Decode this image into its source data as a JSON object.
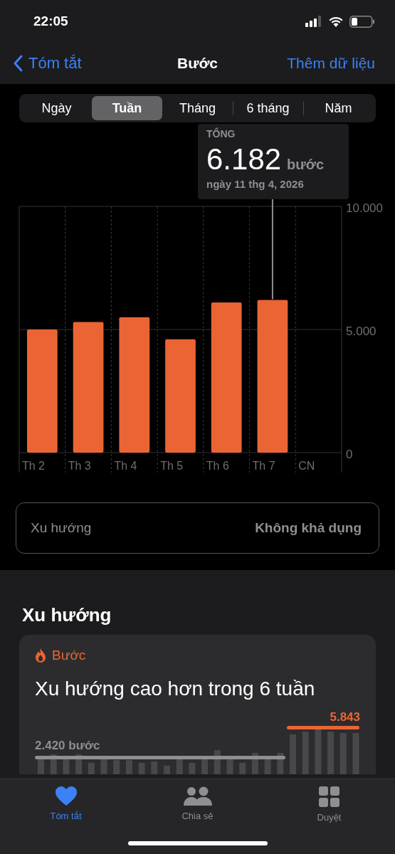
{
  "status_bar": {
    "time": "22:05"
  },
  "nav": {
    "back": "Tóm tắt",
    "title": "Bước",
    "action": "Thêm dữ liệu"
  },
  "segments": [
    {
      "label": "Ngày",
      "selected": false
    },
    {
      "label": "Tuần",
      "selected": true
    },
    {
      "label": "Tháng",
      "selected": false
    },
    {
      "label": "6 tháng",
      "selected": false
    },
    {
      "label": "Năm",
      "selected": false
    }
  ],
  "tooltip": {
    "heading": "TỔNG",
    "value": "6.182",
    "unit": "bước",
    "date": "ngày 11 thg 4, 2026"
  },
  "chart_data": {
    "type": "bar",
    "categories": [
      "Th 2",
      "Th 3",
      "Th 4",
      "Th 5",
      "Th 6",
      "Th 7",
      "CN"
    ],
    "series": [
      {
        "color": "#eb6534",
        "values": [
          5000,
          5300,
          5500,
          4600,
          6100,
          6200,
          null
        ]
      }
    ],
    "ylim": [
      0,
      10000
    ],
    "yticks": [
      {
        "value": 0,
        "label": "0"
      },
      {
        "value": 5000,
        "label": "5.000"
      },
      {
        "value": 10000,
        "label": "10.000"
      }
    ]
  },
  "trend_row": {
    "label": "Xu hướng",
    "value": "Không khả dụng"
  },
  "trends": {
    "heading": "Xu hướng",
    "card": {
      "category": "Bước",
      "title": "Xu hướng cao hơn trong 6 tuần",
      "old_value": "2.420 bước",
      "new_value": "5.843"
    }
  },
  "tab_bar": [
    {
      "label": "Tóm tắt",
      "selected": true
    },
    {
      "label": "Chia sẻ",
      "selected": false
    },
    {
      "label": "Duyệt",
      "selected": false
    }
  ]
}
